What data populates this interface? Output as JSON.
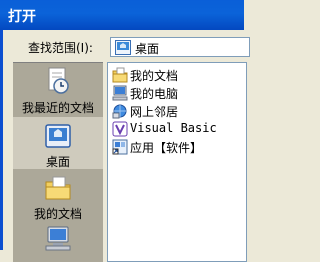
{
  "dialog": {
    "title": "打开"
  },
  "lookin": {
    "label": "查找范围(I):",
    "value": "桌面"
  },
  "places": [
    {
      "label": "我最近的文档",
      "icon": "recent-documents-icon"
    },
    {
      "label": "桌面",
      "icon": "desktop-icon",
      "selected": true
    },
    {
      "label": "我的文档",
      "icon": "my-documents-icon"
    },
    {
      "label": "",
      "icon": "my-computer-icon"
    }
  ],
  "files": [
    {
      "label": "我的文档",
      "icon": "my-documents-icon"
    },
    {
      "label": "我的电脑",
      "icon": "my-computer-icon"
    },
    {
      "label": "网上邻居",
      "icon": "network-places-icon"
    },
    {
      "label": "Visual Basic",
      "icon": "visual-basic-icon"
    },
    {
      "label": "应用【软件】",
      "icon": "shortcut-icon"
    }
  ],
  "colors": {
    "titlebar": "#0b5ad6",
    "dialog_bg": "#ece9d8",
    "places_bg": "#aca899"
  }
}
